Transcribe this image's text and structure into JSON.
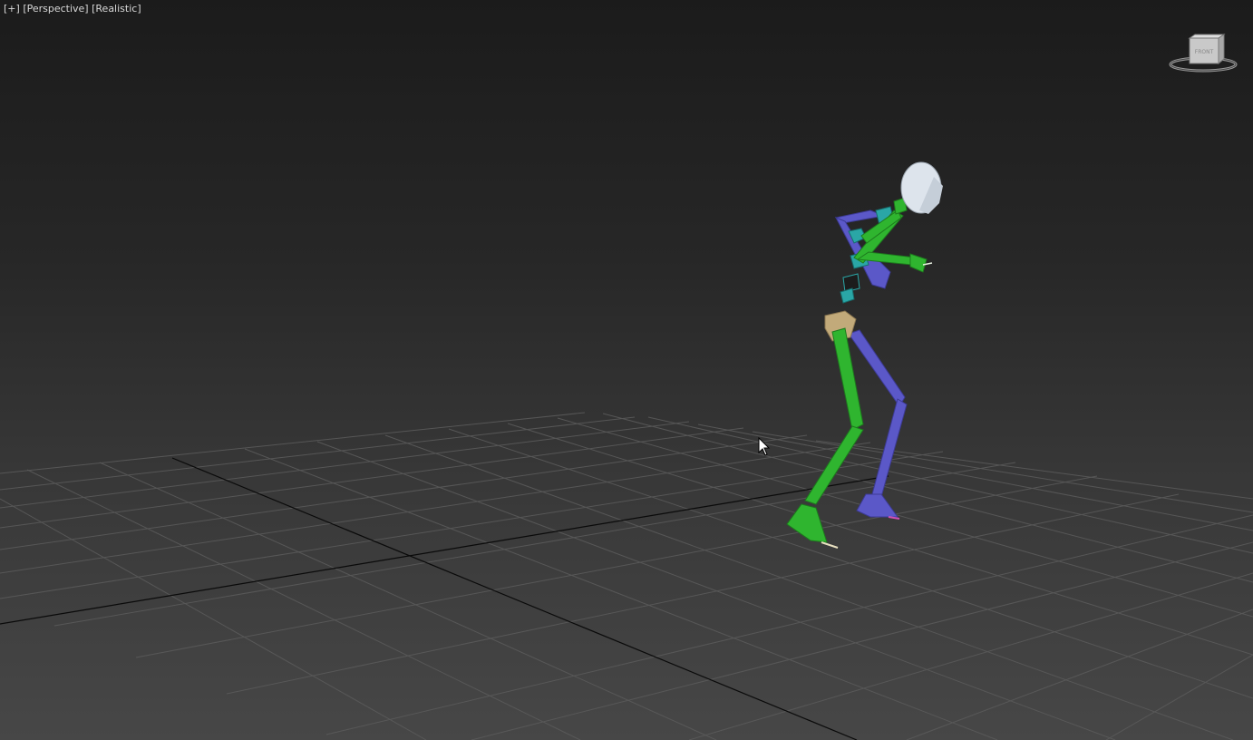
{
  "viewport": {
    "labels": {
      "menu": "[+]",
      "view": "[Perspective]",
      "shading": "[Realistic]"
    },
    "viewcube": {
      "icon": "viewcube-icon",
      "face_label": "FRONT"
    },
    "grid": {
      "visible": true,
      "line_color": "#5c5c5c",
      "axis_color": "#000000"
    },
    "colors": {
      "background_top": "#1b1b1b",
      "background_bottom": "#474747",
      "right_side_limbs": "#2fb52f",
      "left_side_limbs": "#5b58c8",
      "spine": "#2aa6a6",
      "pelvis": "#c2aa7a",
      "head": "#dde4ec"
    },
    "cursor": "arrow-cursor-icon"
  }
}
